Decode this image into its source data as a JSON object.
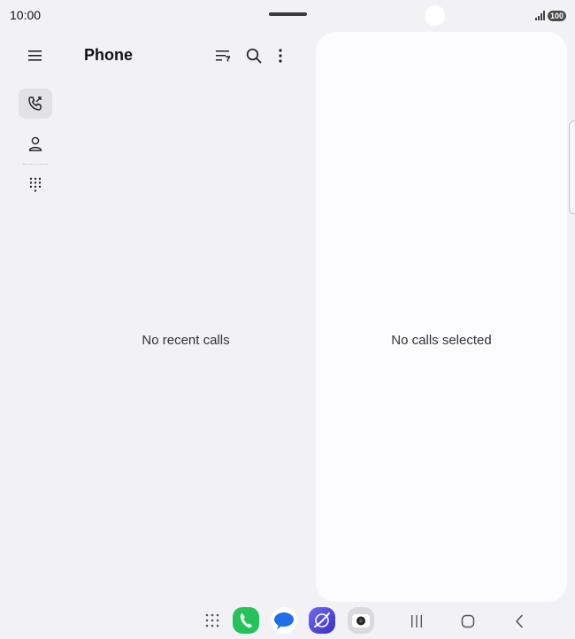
{
  "status_bar": {
    "time": "10:00",
    "battery": "100"
  },
  "header": {
    "title": "Phone"
  },
  "list": {
    "empty_text": "No recent calls"
  },
  "detail": {
    "empty_text": "No calls selected"
  },
  "icons": {
    "menu": "hamburger-icon",
    "recents": "call-log-icon",
    "contacts": "person-icon",
    "keypad": "dialpad-icon",
    "filter": "filter-sort-icon",
    "search": "search-icon",
    "more": "more-vertical-icon"
  },
  "colors": {
    "background": "#f2f2f6",
    "panel": "#fcfcff",
    "phone_app": "#25c25b",
    "internet_app": "#5a52e0"
  }
}
